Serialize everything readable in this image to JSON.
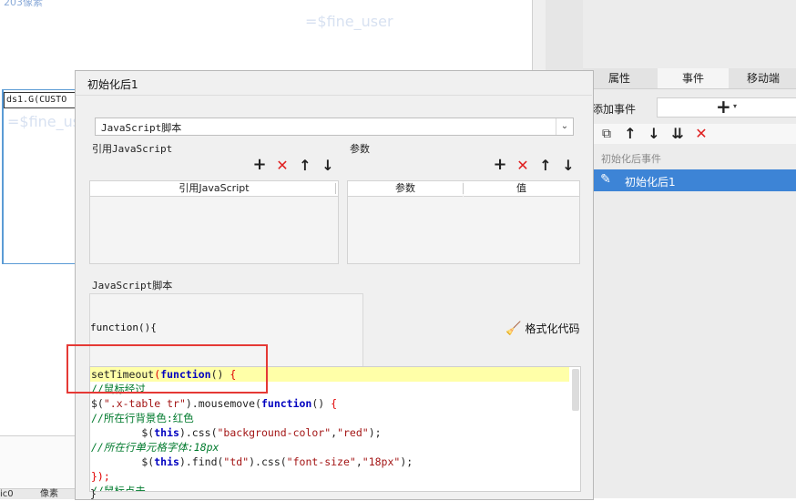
{
  "canvas": {
    "top_fragment": "203像素",
    "watermark": "=$fine_user",
    "cell_ref": "ds1.G(CUSTO",
    "bottom_tabs": [
      "ic0",
      "像素"
    ]
  },
  "right_panel": {
    "tabs": [
      {
        "label": "属性",
        "active": false
      },
      {
        "label": "事件",
        "active": true
      },
      {
        "label": "移动端",
        "active": false
      }
    ],
    "add_event_label": "添加事件",
    "event_group": "初始化后事件",
    "event_item": "初始化后1",
    "toolbar_icons": [
      "copy-icon",
      "arrow-up-icon",
      "arrow-down-icon",
      "move-bottom-icon",
      "delete-icon"
    ]
  },
  "dialog": {
    "title": "初始化后1",
    "type_select": "JavaScript脚本",
    "ref_js_label": "引用JavaScript",
    "params_label": "参数",
    "ref_table_header": "引用JavaScript",
    "params_table": {
      "col1": "参数",
      "col2": "值"
    },
    "script_label": "JavaScript脚本",
    "function_open": "function(){",
    "format_button": "格式化代码",
    "code_lines": [
      "setTimeout(function() {",
      "//鼠标经过",
      "$(\".x-table tr\").mousemove(function() {",
      "//所在行背景色:红色",
      "        $(this).css(\"background-color\",\"red\");",
      "//所在行单元格字体:18px",
      "        $(this).find(\"td\").css(\"font-size\",\"18px\");",
      "});",
      "//鼠标点击",
      "}"
    ]
  },
  "colors": {
    "accent": "#3d84d6",
    "delete": "#e02020",
    "highlight_line": "#ffffa8",
    "annotation_box": "#e53935"
  }
}
